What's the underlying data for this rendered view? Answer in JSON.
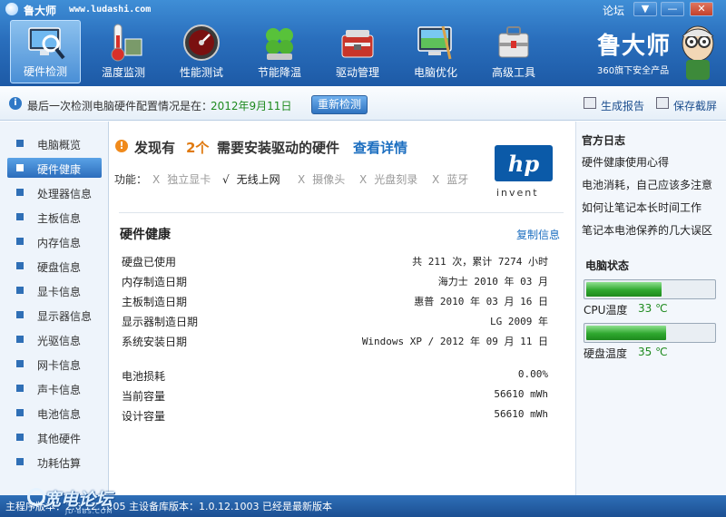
{
  "titlebar": {
    "app_name": "鲁大师",
    "url": "www.ludashi.com",
    "forum": "论坛",
    "menu_glyph": "▼",
    "minimize_glyph": "—",
    "close_glyph": "✕"
  },
  "toolbar": {
    "items": [
      {
        "label": "硬件检测",
        "icon": "monitor-magnifier-icon"
      },
      {
        "label": "温度监测",
        "icon": "thermometer-icon"
      },
      {
        "label": "性能测试",
        "icon": "speedometer-icon"
      },
      {
        "label": "节能降温",
        "icon": "clover-icon"
      },
      {
        "label": "驱动管理",
        "icon": "toolbox-icon"
      },
      {
        "label": "电脑优化",
        "icon": "screen-broom-icon"
      },
      {
        "label": "高级工具",
        "icon": "toolkit-icon"
      }
    ],
    "active_index": 0
  },
  "brand": {
    "name": "鲁大师",
    "subtitle": "360旗下安全产品"
  },
  "infobar": {
    "text": "最后一次检测电脑硬件配置情况是在：",
    "date": "2012年9月11日",
    "recheck": "重新检测",
    "report": "生成报告",
    "screenshot": "保存截屏"
  },
  "sidebar": {
    "items": [
      "电脑概览",
      "硬件健康",
      "处理器信息",
      "主板信息",
      "内存信息",
      "硬盘信息",
      "显卡信息",
      "显示器信息",
      "光驱信息",
      "网卡信息",
      "声卡信息",
      "电池信息",
      "其他硬件",
      "功耗估算"
    ],
    "active_index": 1
  },
  "main": {
    "find_pre": "发现有",
    "find_count": "2个",
    "find_post": "需要安装驱动的硬件",
    "find_detail": "查看详情",
    "func_label": "功能：",
    "features": [
      {
        "mark": "X",
        "label": "独立显卡",
        "ok": false
      },
      {
        "mark": "√",
        "label": "无线上网",
        "ok": true
      },
      {
        "mark": "X",
        "label": "摄像头",
        "ok": false
      },
      {
        "mark": "X",
        "label": "光盘刻录",
        "ok": false
      },
      {
        "mark": "X",
        "label": "蓝牙",
        "ok": false
      }
    ],
    "vendor_logo": "hp",
    "vendor_tagline": "invent",
    "section_title": "硬件健康",
    "copy_info": "复制信息",
    "rows": [
      {
        "k": "硬盘已使用",
        "v": "共 211 次，累计 7274 小时"
      },
      {
        "k": "内存制造日期",
        "v": "海力士 2010 年 03 月"
      },
      {
        "k": "主板制造日期",
        "v": "惠普 2010 年 03 月 16 日"
      },
      {
        "k": "显示器制造日期",
        "v": "LG 2009 年"
      },
      {
        "k": "系统安装日期",
        "v": "Windows XP / 2012 年 09 月 11 日"
      }
    ],
    "battery_rows": [
      {
        "k": "电池损耗",
        "v": "0.00%"
      },
      {
        "k": "当前容量",
        "v": "56610 mWh"
      },
      {
        "k": "设计容量",
        "v": "56610 mWh"
      }
    ]
  },
  "right": {
    "blog_title": "官方日志",
    "links": [
      "硬件健康使用心得",
      "电池消耗，自己应该多注意",
      "如何让笔记本长时间工作",
      "笔记本电池保养的几大误区"
    ],
    "status_title": "电脑状态",
    "cpu": {
      "label": "CPU温度",
      "value": "33 ℃",
      "level": 0.33
    },
    "disk": {
      "label": "硬盘温度",
      "value": "35 ℃",
      "level": 0.35
    }
  },
  "statusbar": {
    "text": "主程序版本：2.6.12.1005   主设备库版本：1.0.12.1003   已经是最新版本",
    "watermark": "宽电论坛",
    "watermark_sub": "JD-BBS.COM"
  }
}
